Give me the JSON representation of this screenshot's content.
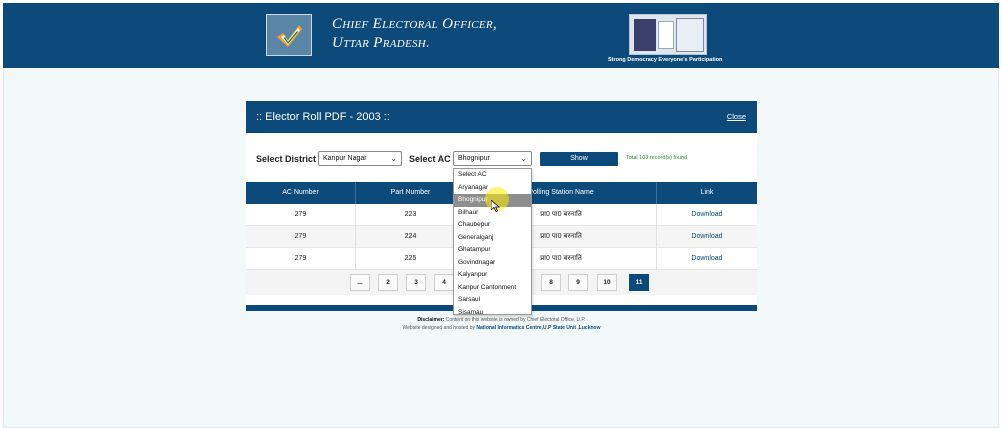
{
  "header": {
    "title_line1": "Chief Electoral Officer,",
    "title_line2": "Uttar Pradesh.",
    "tagline": "Strong Democracy Everyone's Participation",
    "colors": {
      "primary": "#0d4a7c",
      "background": "#f3f8f8"
    }
  },
  "panel": {
    "title": ":: Elector Roll PDF - 2003 ::",
    "close_label": "Close",
    "district_label": "Select District",
    "district_value": "Kanpur Nagar",
    "ac_label": "Select AC",
    "ac_value": "Bhognipur",
    "show_label": "Show",
    "records_text": "Total 103 record(s) found"
  },
  "table": {
    "columns": [
      "AC Number",
      "Part Number",
      "Polling Station Name",
      "Link"
    ],
    "rows": [
      {
        "ac": "279",
        "part": "223",
        "station": "प्रा0 पा0 बरनाति",
        "link": "Download"
      },
      {
        "ac": "279",
        "part": "224",
        "station": "प्रा0 पा0 बरनाति",
        "link": "Download"
      },
      {
        "ac": "279",
        "part": "225",
        "station": "प्रा0 पा0 बरनाति",
        "link": "Download"
      }
    ]
  },
  "pager": {
    "left_pages": [
      "...",
      "2",
      "3",
      "4"
    ],
    "right_pages": [
      "8",
      "9",
      "10",
      "11"
    ],
    "active_page": "11"
  },
  "dropdown": {
    "options": [
      "Select AC",
      "Aryanagar",
      "Bhognipur",
      "Bilhaur",
      "Chaubepur",
      "Generalganj",
      "Ghatampur",
      "Govindnagar",
      "Kalyanpur",
      "Kanpur Cantonment",
      "Sarsaul",
      "Sisamau"
    ],
    "highlighted": "Bhognipur"
  },
  "footer": {
    "disclaimer_label": "Disclaimer:",
    "disclaimer_text": " Content on this website is owned by Chief Electoral Office, U.P.",
    "hosted_text": "Website designed and hosted by ",
    "hosted_org": "National Informatics Centre,U.P State Unit ,Lucknow"
  }
}
